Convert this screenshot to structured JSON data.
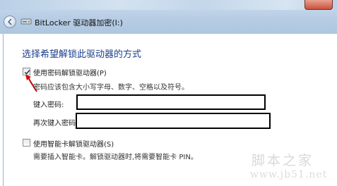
{
  "window": {
    "title": "BitLocker 驱动器加密(I:)"
  },
  "page": {
    "heading": "选择希望解锁此驱动器的方式"
  },
  "password_option": {
    "checked": true,
    "label": "使用密码解锁驱动器(P)",
    "hint": "密码应该包含大小写字母、数字、空格以及符号。",
    "enter_label": "键入密码:",
    "enter_value": "",
    "reenter_label": "再次键入密码:",
    "reenter_value": ""
  },
  "smartcard_option": {
    "checked": false,
    "label": "使用智能卡解锁驱动器(S)",
    "hint": "需要插入智能卡。解锁驱动器时,将需要智能卡 PIN。"
  },
  "watermark": {
    "site_cn": "脚本之家",
    "site_url": "www.jb51.net"
  },
  "colors": {
    "heading": "#1a3e8c",
    "annotation_arrow": "#d40000",
    "annotation_box": "#000000"
  }
}
